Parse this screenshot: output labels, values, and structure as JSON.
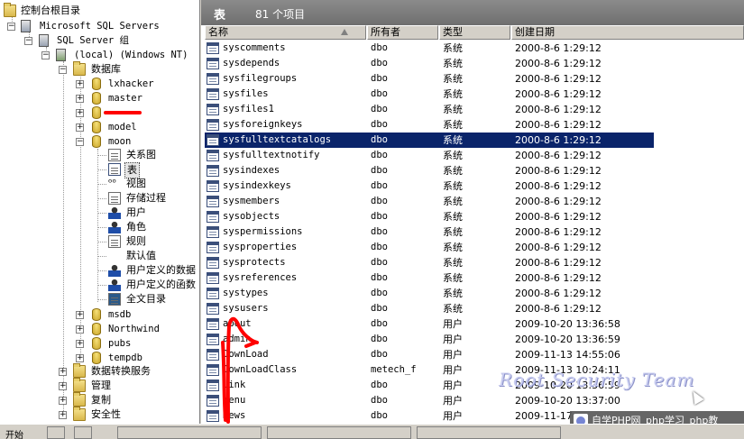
{
  "tree": {
    "root": "控制台根目录",
    "servers": "Microsoft SQL Servers",
    "group": "SQL Server 组",
    "instance": "(local) (Windows NT)",
    "databases_folder": "数据库",
    "databases": [
      "lxhacker",
      "master",
      "",
      "model",
      "moon"
    ],
    "moon_children": [
      "关系图",
      "表",
      "视图",
      "存储过程",
      "用户",
      "角色",
      "规则",
      "默认值",
      "用户定义的数据",
      "用户定义的函数",
      "全文目录"
    ],
    "other_databases": [
      "msdb",
      "Northwind",
      "pubs",
      "tempdb"
    ],
    "folders": [
      "数据转换服务",
      "管理",
      "复制",
      "安全性"
    ]
  },
  "header": {
    "title": "表",
    "count": "81 个项目"
  },
  "columns": [
    "名称",
    "所有者",
    "类型",
    "创建日期"
  ],
  "rows": [
    {
      "name": "syscomments",
      "owner": "dbo",
      "type": "系统",
      "date": "2000-8-6 1:29:12"
    },
    {
      "name": "sysdepends",
      "owner": "dbo",
      "type": "系统",
      "date": "2000-8-6 1:29:12"
    },
    {
      "name": "sysfilegroups",
      "owner": "dbo",
      "type": "系统",
      "date": "2000-8-6 1:29:12"
    },
    {
      "name": "sysfiles",
      "owner": "dbo",
      "type": "系统",
      "date": "2000-8-6 1:29:12"
    },
    {
      "name": "sysfiles1",
      "owner": "dbo",
      "type": "系统",
      "date": "2000-8-6 1:29:12"
    },
    {
      "name": "sysforeignkeys",
      "owner": "dbo",
      "type": "系统",
      "date": "2000-8-6 1:29:12"
    },
    {
      "name": "sysfulltextcatalogs",
      "owner": "dbo",
      "type": "系统",
      "date": "2000-8-6 1:29:12"
    },
    {
      "name": "sysfulltextnotify",
      "owner": "dbo",
      "type": "系统",
      "date": "2000-8-6 1:29:12"
    },
    {
      "name": "sysindexes",
      "owner": "dbo",
      "type": "系统",
      "date": "2000-8-6 1:29:12"
    },
    {
      "name": "sysindexkeys",
      "owner": "dbo",
      "type": "系统",
      "date": "2000-8-6 1:29:12"
    },
    {
      "name": "sysmembers",
      "owner": "dbo",
      "type": "系统",
      "date": "2000-8-6 1:29:12"
    },
    {
      "name": "sysobjects",
      "owner": "dbo",
      "type": "系统",
      "date": "2000-8-6 1:29:12"
    },
    {
      "name": "syspermissions",
      "owner": "dbo",
      "type": "系统",
      "date": "2000-8-6 1:29:12"
    },
    {
      "name": "sysproperties",
      "owner": "dbo",
      "type": "系统",
      "date": "2000-8-6 1:29:12"
    },
    {
      "name": "sysprotects",
      "owner": "dbo",
      "type": "系统",
      "date": "2000-8-6 1:29:12"
    },
    {
      "name": "sysreferences",
      "owner": "dbo",
      "type": "系统",
      "date": "2000-8-6 1:29:12"
    },
    {
      "name": "systypes",
      "owner": "dbo",
      "type": "系统",
      "date": "2000-8-6 1:29:12"
    },
    {
      "name": "sysusers",
      "owner": "dbo",
      "type": "系统",
      "date": "2000-8-6 1:29:12"
    },
    {
      "name": "about",
      "owner": "dbo",
      "type": "用户",
      "date": "2009-10-20 13:36:58"
    },
    {
      "name": "admin",
      "owner": "dbo",
      "type": "用户",
      "date": "2009-10-20 13:36:59"
    },
    {
      "name": "DownLoad",
      "owner": "dbo",
      "type": "用户",
      "date": "2009-11-13 14:55:06"
    },
    {
      "name": "DownLoadClass",
      "owner": "metech_f",
      "type": "用户",
      "date": "2009-11-13 10:24:11"
    },
    {
      "name": "link",
      "owner": "dbo",
      "type": "用户",
      "date": "2009-10-20 13:36:59"
    },
    {
      "name": "Menu",
      "owner": "dbo",
      "type": "用户",
      "date": "2009-10-20 13:37:00"
    },
    {
      "name": "News",
      "owner": "dbo",
      "type": "用户",
      "date": "2009-11-17"
    }
  ],
  "selected_row": 6,
  "watermark": "Root Security Team",
  "badge": "自学PHP网_php学习_php教",
  "taskbar": {
    "start": "开始"
  },
  "colors": {
    "header": "#7a7a7a",
    "selection": "#0a246a",
    "annotation": "#ff0000",
    "watermark": "#c9cdf0"
  }
}
